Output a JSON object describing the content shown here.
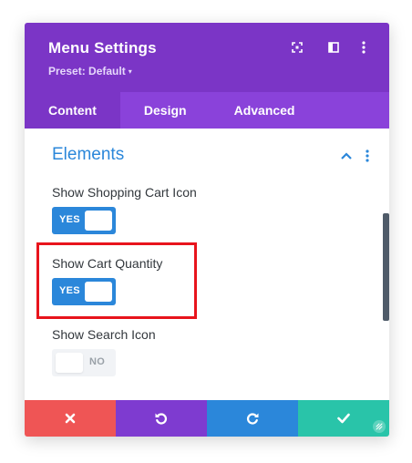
{
  "header": {
    "title": "Menu Settings",
    "preset_label": "Preset: Default",
    "preset_caret": "▾"
  },
  "tabs": [
    {
      "label": "Content",
      "active": true
    },
    {
      "label": "Design",
      "active": false
    },
    {
      "label": "Advanced",
      "active": false
    }
  ],
  "section": {
    "title": "Elements"
  },
  "options": [
    {
      "label": "Show Shopping Cart Icon",
      "state": "YES"
    },
    {
      "label": "Show Cart Quantity",
      "state": "YES"
    },
    {
      "label": "Show Search Icon",
      "state": "NO"
    }
  ],
  "colors": {
    "header": "#7b35c6",
    "tabs": "#8a42da",
    "accent_blue": "#2b87da",
    "cancel": "#ef5555",
    "undo": "#7e3bd0",
    "redo": "#2b87da",
    "save": "#29c4a9",
    "highlight": "#e8141c"
  },
  "icons": {
    "expand": "expand-icon",
    "split_view": "split-view-icon",
    "more": "more-vertical-icon",
    "collapse": "chevron-up-icon",
    "cancel": "close-icon",
    "undo": "undo-icon",
    "redo": "redo-icon",
    "save": "check-icon",
    "resize": "resize-icon"
  }
}
